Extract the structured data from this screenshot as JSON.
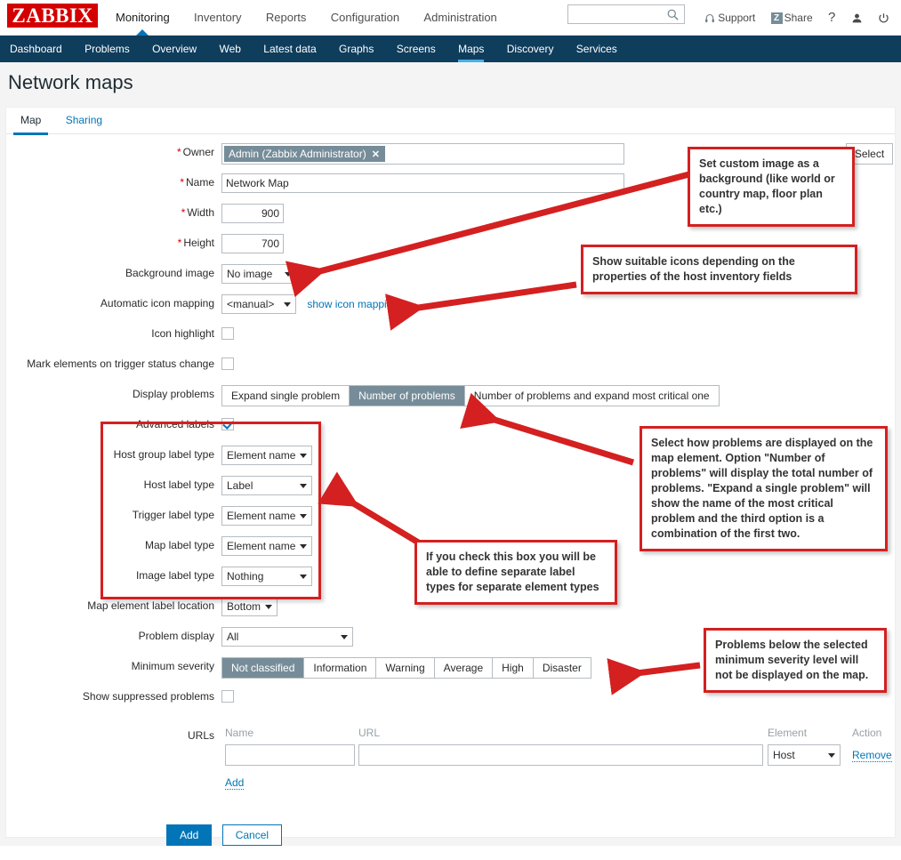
{
  "header": {
    "logo": "ZABBIX",
    "main_menu": [
      {
        "label": "Monitoring",
        "active": true
      },
      {
        "label": "Inventory",
        "active": false
      },
      {
        "label": "Reports",
        "active": false
      },
      {
        "label": "Configuration",
        "active": false
      },
      {
        "label": "Administration",
        "active": false
      }
    ],
    "search_placeholder": "",
    "search_value": "",
    "support_label": "Support",
    "share_label": "Share",
    "share_badge": "Z",
    "help_label": "?",
    "user_icon": "user-icon",
    "signout_icon": "power-icon"
  },
  "subnav": [
    {
      "label": "Dashboard",
      "active": false
    },
    {
      "label": "Problems",
      "active": false
    },
    {
      "label": "Overview",
      "active": false
    },
    {
      "label": "Web",
      "active": false
    },
    {
      "label": "Latest data",
      "active": false
    },
    {
      "label": "Graphs",
      "active": false
    },
    {
      "label": "Screens",
      "active": false
    },
    {
      "label": "Maps",
      "active": true
    },
    {
      "label": "Discovery",
      "active": false
    },
    {
      "label": "Services",
      "active": false
    }
  ],
  "page": {
    "title": "Network maps"
  },
  "tabs": [
    {
      "label": "Map",
      "active": true
    },
    {
      "label": "Sharing",
      "active": false
    }
  ],
  "form": {
    "owner": {
      "label": "Owner",
      "required": true,
      "chip_value": "Admin (Zabbix Administrator)",
      "chip_remove": "✕",
      "select_button": "Select"
    },
    "name": {
      "label": "Name",
      "required": true,
      "value": "Network Map"
    },
    "width": {
      "label": "Width",
      "required": true,
      "value": "900"
    },
    "height": {
      "label": "Height",
      "required": true,
      "value": "700"
    },
    "background_image": {
      "label": "Background image",
      "value": "No image"
    },
    "automatic_icon_mapping": {
      "label": "Automatic icon mapping",
      "value": "<manual>",
      "link": "show icon mappings"
    },
    "icon_highlight": {
      "label": "Icon highlight",
      "checked": false
    },
    "mark_elements": {
      "label": "Mark elements on trigger status change",
      "checked": false
    },
    "display_problems": {
      "label": "Display problems",
      "options": [
        "Expand single problem",
        "Number of problems",
        "Number of problems and expand most critical one"
      ],
      "selected": "Number of problems"
    },
    "advanced_labels": {
      "label": "Advanced labels",
      "checked": true
    },
    "host_group_label_type": {
      "label": "Host group label type",
      "value": "Element name"
    },
    "host_label_type": {
      "label": "Host label type",
      "value": "Label"
    },
    "trigger_label_type": {
      "label": "Trigger label type",
      "value": "Element name"
    },
    "map_label_type": {
      "label": "Map label type",
      "value": "Element name"
    },
    "image_label_type": {
      "label": "Image label type",
      "value": "Nothing"
    },
    "map_element_label_location": {
      "label": "Map element label location",
      "value": "Bottom"
    },
    "problem_display": {
      "label": "Problem display",
      "value": "All"
    },
    "minimum_severity": {
      "label": "Minimum severity",
      "options": [
        "Not classified",
        "Information",
        "Warning",
        "Average",
        "High",
        "Disaster"
      ],
      "selected": "Not classified"
    },
    "show_suppressed": {
      "label": "Show suppressed problems",
      "checked": false
    },
    "urls": {
      "label": "URLs",
      "columns": [
        "Name",
        "URL",
        "Element",
        "Action"
      ],
      "rows": [
        {
          "name": "",
          "url": "",
          "element": "Host",
          "action": "Remove"
        }
      ],
      "add_link": "Add"
    }
  },
  "footer": {
    "submit": "Add",
    "cancel": "Cancel"
  },
  "annotations": [
    {
      "id": "background-image-note",
      "text": "Set custom image as a background (like world or country map, floor plan etc.)"
    },
    {
      "id": "icon-mapping-note",
      "text": "Show suitable icons depending on the properties of the host inventory fields"
    },
    {
      "id": "display-problems-note",
      "text": "Select how problems are displayed on the map element. Option \"Number of problems\" will display the total number of problems. \"Expand a single problem\" will show the name of the most critical problem and the third option is a combination of the first two."
    },
    {
      "id": "advanced-labels-note",
      "text": "If you check this box you will be able to define separate label types for separate element types"
    },
    {
      "id": "minimum-severity-note",
      "text": "Problems below the selected minimum severity level will not be displayed on the map."
    }
  ],
  "colors": {
    "brand_red": "#d40000",
    "nav_dark": "#0f3d5c",
    "accent_blue": "#0275b8",
    "selected_gray": "#768d99",
    "annotation_red": "#d42020",
    "focus_field": "#e8edfa"
  }
}
